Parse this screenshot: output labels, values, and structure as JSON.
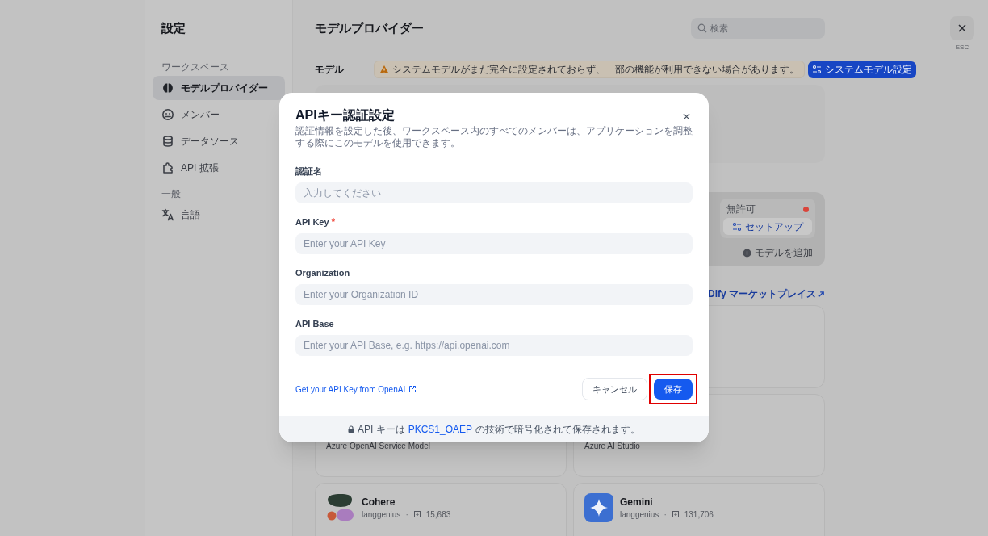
{
  "settings_sidebar": {
    "title": "設定",
    "sections": [
      {
        "heading": "ワークスペース",
        "items": [
          {
            "label": "モデルプロバイダー",
            "selected": true
          },
          {
            "label": "メンバー",
            "selected": false
          },
          {
            "label": "データソース",
            "selected": false
          },
          {
            "label": "API 拡張",
            "selected": false
          }
        ]
      },
      {
        "heading": "一般",
        "items": [
          {
            "label": "言語",
            "selected": false
          }
        ]
      }
    ]
  },
  "main": {
    "title": "モデルプロバイダー",
    "search": {
      "placeholder": "検索"
    },
    "close_hint": "ESC",
    "model_section": {
      "label": "モデル",
      "warning": "システムモデルがまだ完全に設定されておらず、一部の機能が利用できない場合があります。",
      "button": "システムモデル設定"
    },
    "provider_card": {
      "status": "無許可",
      "setup_button": "セットアップ",
      "add_model": "モデルを追加"
    },
    "marketplace": {
      "link": "Dify マーケットプレイス"
    },
    "providers": [
      {
        "description": "Azure OpenAI Service Model"
      },
      {
        "description": "Azure AI Studio"
      },
      {
        "name": "Cohere",
        "author": "langgenius",
        "separator": "·",
        "installs": "15,683"
      },
      {
        "name": "Gemini",
        "author": "langgenius",
        "separator": "·",
        "installs": "131,706"
      }
    ]
  },
  "dialog": {
    "title": "APIキー認証設定",
    "description": "認証情報を設定した後、ワークスペース内のすべてのメンバーは、アプリケーションを調整する際にこのモデルを使用できます。",
    "fields": [
      {
        "label": "認証名",
        "placeholder": "入力してください"
      },
      {
        "label": "API Key",
        "required_mark": "*",
        "placeholder": "Enter your API Key"
      },
      {
        "label": "Organization",
        "placeholder": "Enter your Organization ID"
      },
      {
        "label": "API Base",
        "placeholder": "Enter your API Base, e.g. https://api.openai.com"
      }
    ],
    "help_link": "Get your API Key from OpenAI",
    "cancel_button": "キャンセル",
    "save_button": {
      "label": "保存",
      "highlighted": true
    },
    "footer": {
      "before": "API キーは",
      "link": "PKCS1_OAEP",
      "after": "の技術で暗号化されて保存されます。"
    }
  }
}
